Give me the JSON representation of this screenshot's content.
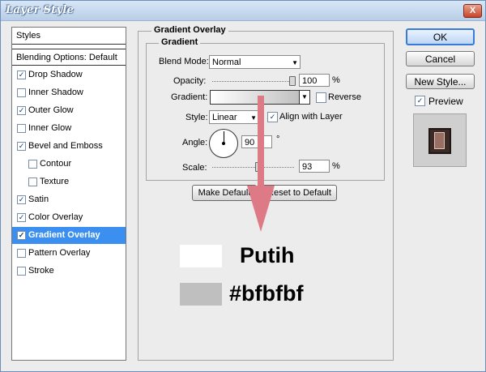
{
  "window": {
    "title": "Layer Style",
    "close_glyph": "X"
  },
  "sidebar": {
    "styles_header": "Styles",
    "blending_header": "Blending Options: Default",
    "items": [
      {
        "label": "Drop Shadow",
        "checked": true
      },
      {
        "label": "Inner Shadow",
        "checked": false
      },
      {
        "label": "Outer Glow",
        "checked": true
      },
      {
        "label": "Inner Glow",
        "checked": false
      },
      {
        "label": "Bevel and Emboss",
        "checked": true
      },
      {
        "label": "Contour",
        "checked": false
      },
      {
        "label": "Texture",
        "checked": false
      },
      {
        "label": "Satin",
        "checked": true
      },
      {
        "label": "Color Overlay",
        "checked": true
      },
      {
        "label": "Gradient Overlay",
        "checked": true,
        "selected": true
      },
      {
        "label": "Pattern Overlay",
        "checked": false
      },
      {
        "label": "Stroke",
        "checked": false
      }
    ],
    "check_glyph": "✓"
  },
  "panel": {
    "title": "Gradient Overlay",
    "group_title": "Gradient",
    "blend_mode": {
      "label": "Blend Mode:",
      "value": "Normal"
    },
    "opacity": {
      "label": "Opacity:",
      "value": "100",
      "unit": "%",
      "level_percent": 100
    },
    "gradient": {
      "label": "Gradient:",
      "colors": [
        "#ffffff",
        "#bfbfbf"
      ]
    },
    "reverse": {
      "label": "Reverse",
      "checked": false
    },
    "style": {
      "label": "Style:",
      "value": "Linear"
    },
    "align": {
      "label": "Align with Layer",
      "checked": true
    },
    "angle": {
      "label": "Angle:",
      "value": "90",
      "unit": "°"
    },
    "scale": {
      "label": "Scale:",
      "value": "93",
      "unit": "%",
      "level_percent": 93
    },
    "make_default": "Make Default",
    "reset_default": "Reset to Default"
  },
  "buttons": {
    "ok": "OK",
    "cancel": "Cancel",
    "new_style": "New Style..."
  },
  "preview": {
    "label": "Preview",
    "checked": true
  },
  "annotation": {
    "arrow_color": "#de7a85",
    "swatches": [
      {
        "color": "#ffffff",
        "label": "Putih"
      },
      {
        "color": "#bfbfbf",
        "label": "#bfbfbf"
      }
    ]
  }
}
